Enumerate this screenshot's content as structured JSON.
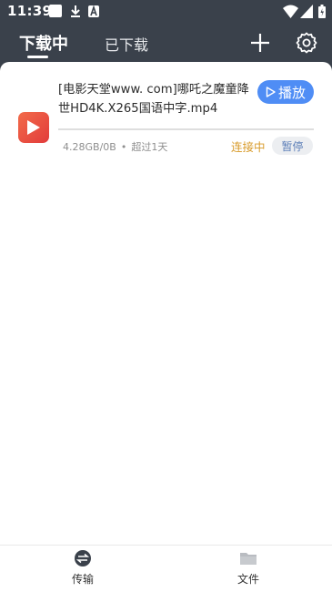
{
  "status_bar": {
    "time": "11:39"
  },
  "header": {
    "tabs": [
      {
        "label": "下载中",
        "active": true
      },
      {
        "label": "已下载",
        "active": false
      }
    ]
  },
  "downloads": [
    {
      "file_name": "[电影天堂www.          com]哪吒之魔童降世HD4K.X265国语中字.mp4",
      "play_label": "播放",
      "progress": 0,
      "size_text": "4.28GB/0B",
      "time_text": "超过1天",
      "state": "连接中",
      "pause_label": "暂停"
    }
  ],
  "bottom_nav": {
    "items": [
      {
        "label": "传输",
        "icon": "transfer-icon",
        "active": true
      },
      {
        "label": "文件",
        "icon": "folder-icon",
        "active": false
      }
    ]
  },
  "colors": {
    "accent": "#4f8df5",
    "header_bg": "#3a414b",
    "status_connecting": "#d89b2a",
    "file_icon": "#e8463e"
  }
}
